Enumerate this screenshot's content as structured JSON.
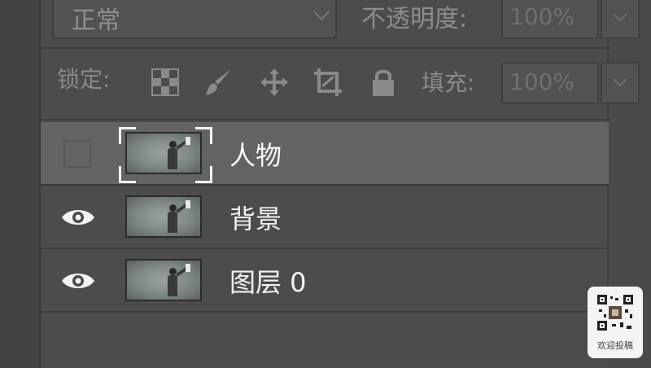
{
  "blend_mode": {
    "value": "正常"
  },
  "opacity": {
    "label": "不透明度:",
    "value": "100%"
  },
  "lock": {
    "label": "锁定:"
  },
  "fill": {
    "label": "填充:",
    "value": "100%"
  },
  "layers": [
    {
      "name": "人物",
      "visible": false,
      "selected": true
    },
    {
      "name": "背景",
      "visible": true,
      "selected": false
    },
    {
      "name": "图层 0",
      "visible": true,
      "selected": false
    }
  ],
  "watermark": {
    "text": "欢迎投稿"
  },
  "colors": {
    "panel": "#4c4c4c",
    "selected_row": "#636363",
    "text": "#f0f0f0"
  }
}
